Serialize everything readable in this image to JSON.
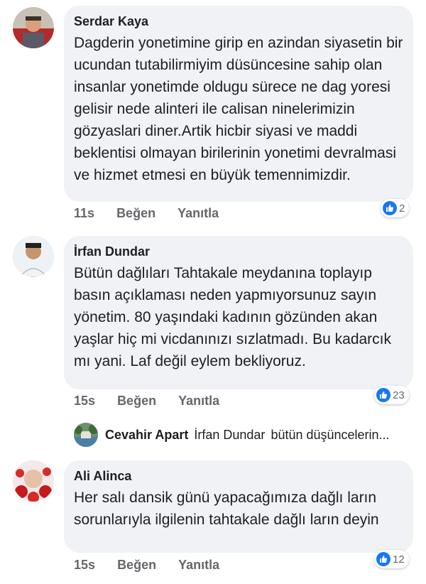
{
  "comments": [
    {
      "author": "Serdar Kaya",
      "text": "Dagderin yonetimine girip en azindan siyasetin bir ucundan tutabilirmiyim düsüncesine sahip olan insanlar yonetimde oldugu sürece ne dag yoresi gelisir nede alinteri ile calisan ninelerimizin gözyaslari diner.Artik hicbir siyasi ve maddi beklentisi olmayan birilerinin yonetimi devralmasi ve hizmet etmesi en büyük temennimizdir.",
      "time": "11s",
      "like_label": "Beğen",
      "reply_label": "Yanıtla",
      "reaction_count": "2",
      "avatar_icon": "user-photo-icon"
    },
    {
      "author": "İrfan Dundar",
      "text": "Bütün dağlıları Tahtakale meydanına toplayıp basın açıklaması neden yapmıyorsunuz sayın yönetim. 80 yaşındaki kadının gözünden akan yaşlar hiç mi vicdanınızı sızlatmadı. Bu kadarcık mı yani. Laf değil eylem bekliyoruz.",
      "time": "15s",
      "like_label": "Beğen",
      "reply_label": "Yanıtla",
      "reaction_count": "23",
      "avatar_icon": "user-photo-icon",
      "reply": {
        "author": "Cevahir Apart",
        "mention": "İrfan Dundar",
        "text": "bütün düşüncelerin..."
      }
    },
    {
      "author": "Ali Alinca",
      "text": "Her salı dansik günü yapacağımıza dağlı ların sorunlarıyla ilgilenin tahtakale dağlı ların deyin",
      "time": "15s",
      "like_label": "Beğen",
      "reply_label": "Yanıtla",
      "reaction_count": "12",
      "avatar_icon": "user-photo-icon"
    }
  ],
  "colors": {
    "bubble": "#f0f2f5",
    "like_blue": "#1877f2",
    "meta_gray": "#65676b"
  }
}
